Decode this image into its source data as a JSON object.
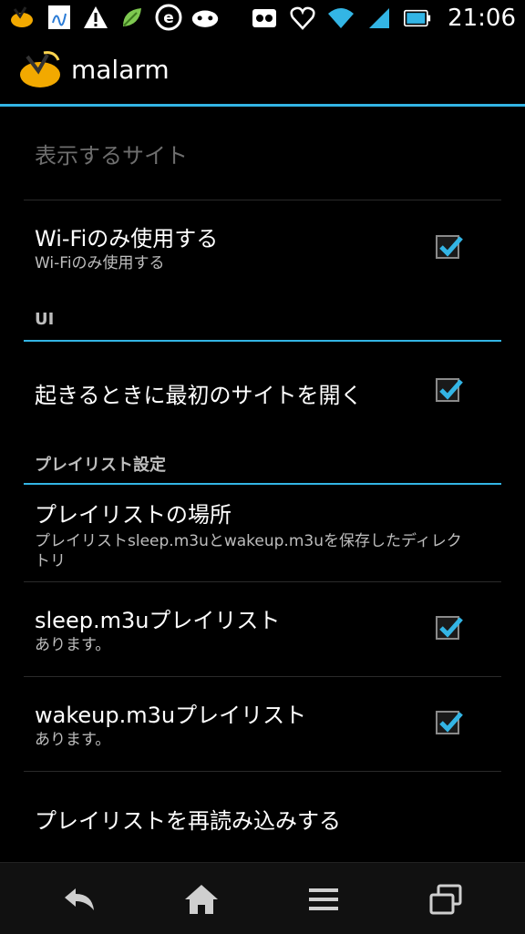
{
  "statusbar": {
    "time": "21:06",
    "left_icons": [
      "malarm-icon",
      "notes-icon",
      "warning-icon",
      "leaf-icon",
      "e-icon",
      "android-icon"
    ],
    "right_icons": [
      "voicemail-icon",
      "heart-icon",
      "wifi-icon",
      "signal-icon",
      "battery-icon"
    ]
  },
  "actionbar": {
    "app_title": "malarm",
    "accent": "#33b5e5"
  },
  "prefs": {
    "site_display": {
      "title": "表示するサイト"
    },
    "wifi_only": {
      "title": "Wi-Fiのみ使用する",
      "summary": "Wi-Fiのみ使用する",
      "checked": true
    },
    "ui_category": "UI",
    "open_first_site": {
      "title": "起きるときに最初のサイトを開く",
      "checked": true
    },
    "playlist_category": "プレイリスト設定",
    "playlist_location": {
      "title": "プレイリストの場所",
      "summary": "プレイリストsleep.m3uとwakeup.m3uを保存したディレクトリ"
    },
    "sleep_playlist": {
      "title": "sleep.m3uプレイリスト",
      "summary": "あります。",
      "checked": true
    },
    "wakeup_playlist": {
      "title": "wakeup.m3uプレイリスト",
      "summary": "あります。",
      "checked": true
    },
    "reload_playlist": {
      "title": "プレイリストを再読み込みする"
    }
  },
  "navbar": {
    "buttons": [
      "back-icon",
      "home-icon",
      "menu-icon",
      "recent-apps-icon"
    ]
  }
}
